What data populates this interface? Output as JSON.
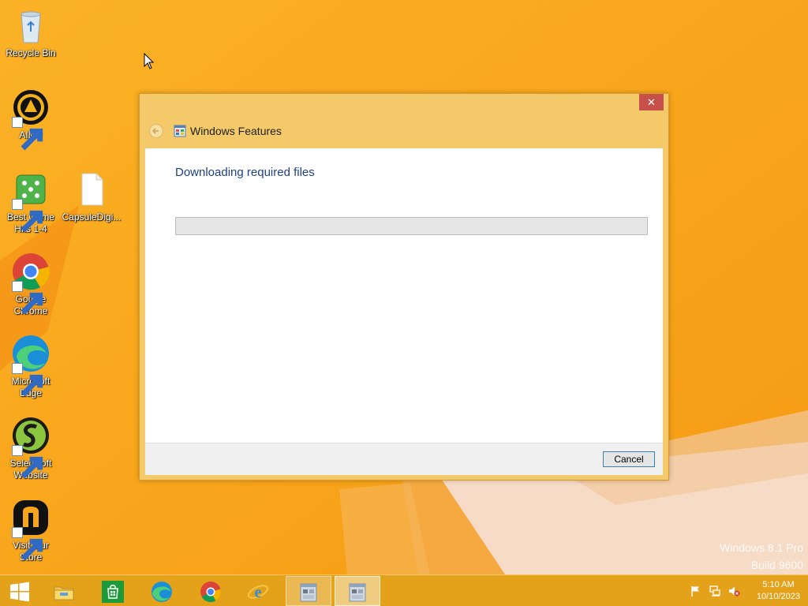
{
  "desktop": {
    "icons": [
      {
        "label": "Recycle Bin",
        "icon": "recycle-bin-icon"
      },
      {
        "label": "AIMP",
        "icon": "aimp-icon"
      },
      {
        "label": "Best Game Hits 1-4",
        "icon": "dice-icon"
      },
      {
        "label": "CapsuleDigi...",
        "icon": "file-icon"
      },
      {
        "label": "Google Chrome",
        "icon": "chrome-icon"
      },
      {
        "label": "Microsoft Edge",
        "icon": "edge-icon"
      },
      {
        "label": "Selectsoft Website",
        "icon": "selectsoft-icon"
      },
      {
        "label": "Visit Our Store",
        "icon": "store-icon"
      }
    ],
    "watermark": {
      "line1": "Windows 8.1 Pro",
      "line2": "Build 9600"
    }
  },
  "dialog": {
    "title": "Windows Features",
    "heading": "Downloading required files",
    "progress": 0,
    "cancel_label": "Cancel",
    "close_symbol": "✕"
  },
  "taskbar": {
    "items": [
      "start-icon",
      "file-explorer-icon",
      "store-icon",
      "edge-icon",
      "chrome-icon",
      "internet-explorer-icon",
      "windows-features-icon",
      "windows-features-icon"
    ],
    "time": "5:10 AM",
    "date": "10/10/2023"
  },
  "colors": {
    "desktop": "#f9a51c",
    "taskbar": "#e3a21a",
    "dialog_frame": "#f3c969",
    "heading": "#1e3f8a",
    "close": "#c7514a"
  }
}
